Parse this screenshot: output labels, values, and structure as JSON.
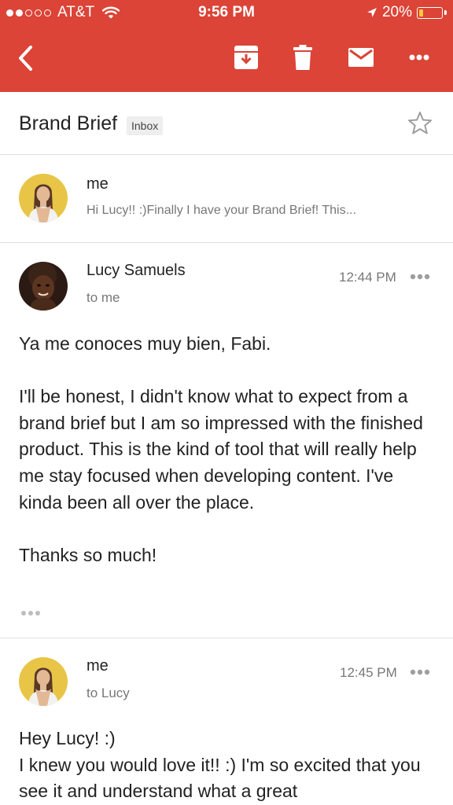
{
  "status_bar": {
    "carrier": "AT&T",
    "time": "9:56 PM",
    "battery": "20%",
    "battery_level": 0.2,
    "signal_bars_filled": 2,
    "signal_bars_total": 5
  },
  "toolbar": {
    "color": "#DB4437",
    "icons": [
      "back-icon",
      "archive-icon",
      "delete-icon",
      "mark-unread-icon",
      "more-icon"
    ]
  },
  "thread": {
    "subject": "Brand Brief",
    "label": "Inbox"
  },
  "messages": [
    {
      "sender": "me",
      "snippet": "Hi Lucy!! :)Finally I have your Brand Brief! This..."
    },
    {
      "sender": "Lucy Samuels",
      "recipient": "to me",
      "time": "12:44 PM",
      "body": [
        "Ya me conoces muy bien, Fabi.",
        "I'll be honest, I didn't know what to expect from a brand brief but I am so impressed with the finished product. This is the kind of tool that will really help me stay focused when developing content. I've kinda been all over the place.",
        "Thanks so much!"
      ]
    },
    {
      "sender": "me",
      "recipient": "to Lucy",
      "time": "12:45 PM",
      "body": [
        "Hey Lucy! :)",
        "I knew you would love it!! :) I'm so excited that you see it and understand what a great"
      ]
    }
  ]
}
